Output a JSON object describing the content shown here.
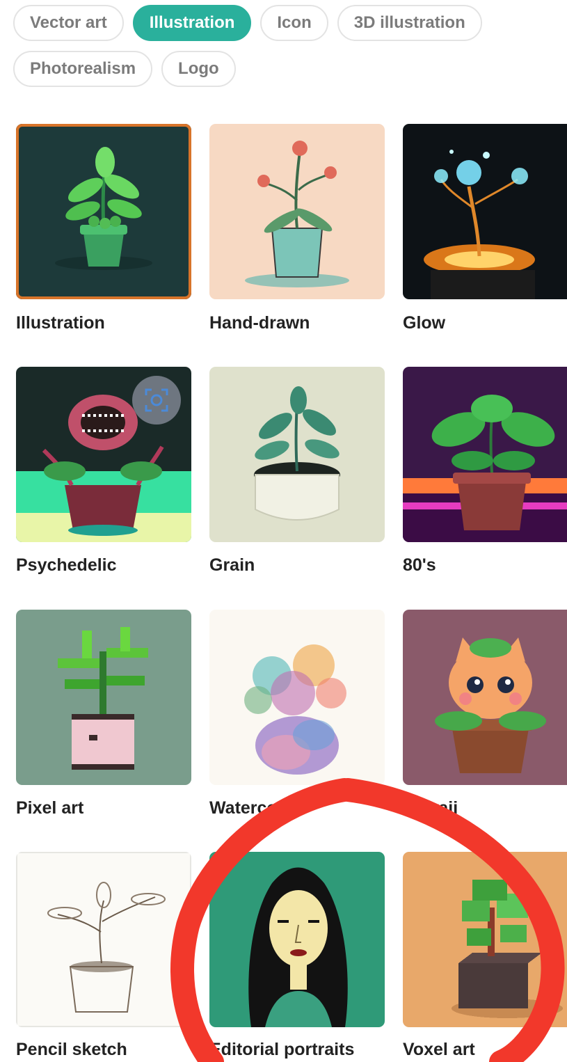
{
  "filters": {
    "row1": [
      {
        "label": "Vector art",
        "active": false
      },
      {
        "label": "Illustration",
        "active": true
      },
      {
        "label": "Icon",
        "active": false
      },
      {
        "label": "3D illustration",
        "active": false
      }
    ],
    "row2": [
      {
        "label": "Photorealism",
        "active": false
      },
      {
        "label": "Logo",
        "active": false
      }
    ]
  },
  "styles": [
    {
      "label": "Illustration",
      "selected": true
    },
    {
      "label": "Hand-drawn",
      "selected": false
    },
    {
      "label": "Glow",
      "selected": false
    },
    {
      "label": "Psychedelic",
      "selected": false
    },
    {
      "label": "Grain",
      "selected": false
    },
    {
      "label": "80's",
      "selected": false
    },
    {
      "label": "Pixel art",
      "selected": false
    },
    {
      "label": "Watercolor",
      "selected": false
    },
    {
      "label": "Kawaii",
      "selected": false
    },
    {
      "label": "Pencil sketch",
      "selected": false
    },
    {
      "label": "Editorial portraits",
      "selected": false
    },
    {
      "label": "Voxel art",
      "selected": false
    }
  ],
  "colors": {
    "accent": "#2ab09c",
    "selected_border": "#d8742a",
    "annotation": "#f2382b"
  }
}
